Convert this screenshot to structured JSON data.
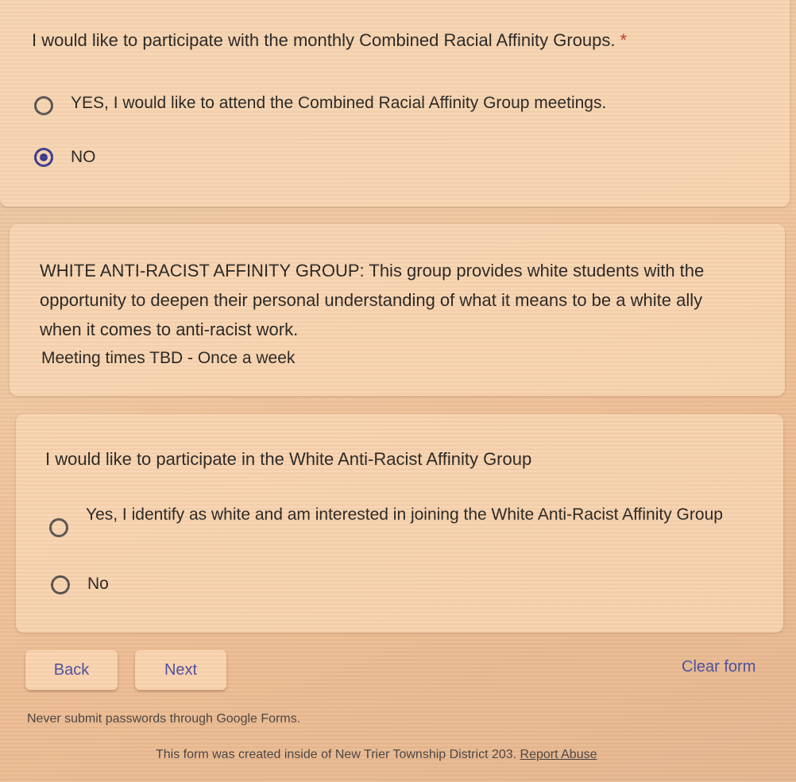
{
  "question_one": {
    "title": "I would like to participate with the monthly Combined Racial Affinity Groups.",
    "required_marker": "*",
    "options": [
      {
        "label": "YES, I would like to attend the Combined Racial Affinity Group meetings.",
        "selected": false
      },
      {
        "label": "NO",
        "selected": true
      }
    ]
  },
  "description": {
    "text": "WHITE ANTI-RACIST AFFINITY GROUP: This group provides white students with the opportunity to deepen their personal understanding of what it means to be a white ally when it comes to anti-racist work.",
    "note": "Meeting times TBD - Once a week"
  },
  "question_two": {
    "title": "I would like to participate in the White Anti-Racist Affinity Group",
    "options": [
      {
        "label": "Yes, I identify as white and am interested in joining the White Anti-Racist Affinity Group",
        "selected": false
      },
      {
        "label": "No",
        "selected": false
      }
    ]
  },
  "navigation": {
    "back_label": "Back",
    "next_label": "Next",
    "clear_label": "Clear form"
  },
  "footer": {
    "password_warning": "Never submit passwords through Google Forms.",
    "created_text": "This form was created inside of New Trier Township District 203.",
    "report_label": "Report Abuse"
  },
  "colors": {
    "accent": "#4b4fa0",
    "radio_checked": "#3b3a8c",
    "required": "#c0392b"
  }
}
